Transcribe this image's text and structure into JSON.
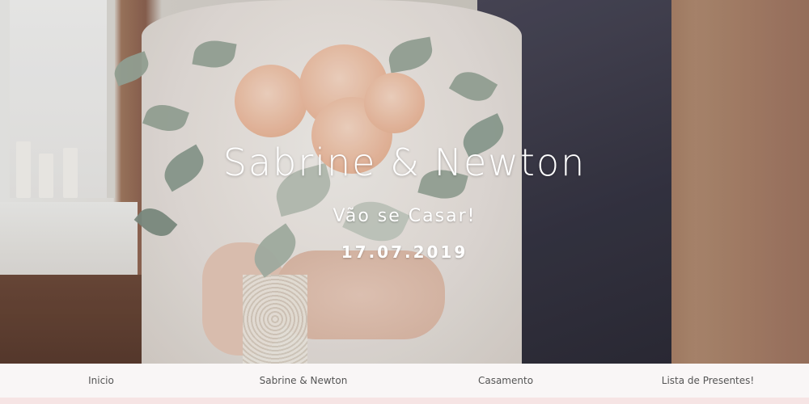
{
  "hero": {
    "names": "Sabrine & Newton",
    "subtitle": "Vão se Casar!",
    "date": "17.07.2019"
  },
  "nav": {
    "items": [
      {
        "label": "Inicio"
      },
      {
        "label": "Sabrine & Newton"
      },
      {
        "label": "Casamento"
      },
      {
        "label": "Lista de Presentes!"
      }
    ]
  },
  "colors": {
    "text": "#ffffff",
    "nav_text": "#555555",
    "nav_bg": "#f8f6f6",
    "accent_strip": "#f6e4e4"
  }
}
